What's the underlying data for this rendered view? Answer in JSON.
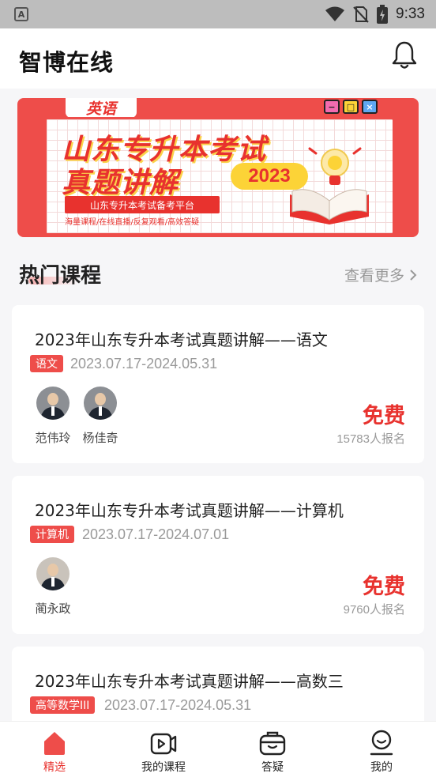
{
  "status_bar": {
    "time": "9:33",
    "notification_icon": "A"
  },
  "header": {
    "title": "智博在线",
    "bell_icon": "bell-icon"
  },
  "banner": {
    "subject": "英语",
    "title_line1": "山东专升本考试",
    "title_line2": "真题讲解",
    "year": "2023",
    "platform": "山东专升本考试备考平台",
    "features": "海量课程/在线直播/反复观看/高效答疑",
    "window_buttons": [
      "−",
      "□",
      "×"
    ]
  },
  "section": {
    "title": "热门课程",
    "more_label": "查看更多"
  },
  "courses": [
    {
      "title": "2023年山东专升本考试真题讲解——语文",
      "tag": "语文",
      "date_range": "2023.07.17-2024.05.31",
      "teachers": [
        "范伟玲",
        "杨佳奇"
      ],
      "price": "免费",
      "enrolled": "15783人报名"
    },
    {
      "title": "2023年山东专升本考试真题讲解——计算机",
      "tag": "计算机",
      "date_range": "2023.07.17-2024.07.01",
      "teachers": [
        "蔺永政"
      ],
      "price": "免费",
      "enrolled": "9760人报名"
    },
    {
      "title": "2023年山东专升本考试真题讲解——高数三",
      "tag": "高等数学III",
      "date_range": "2023.07.17-2024.05.31"
    }
  ],
  "nav": [
    {
      "label": "精选",
      "icon": "home-icon",
      "active": true
    },
    {
      "label": "我的课程",
      "icon": "video-icon"
    },
    {
      "label": "答疑",
      "icon": "qa-box-icon"
    },
    {
      "label": "我的",
      "icon": "user-icon"
    }
  ],
  "colors": {
    "accent": "#e8322e",
    "tag_bg": "#ee4d4a",
    "muted": "#999999"
  }
}
